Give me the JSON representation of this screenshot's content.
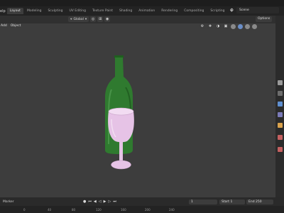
{
  "topbar": {
    "help_label": "elp",
    "tabs": [
      "Layout",
      "Modeling",
      "Sculpting",
      "UV Editing",
      "Texture Paint",
      "Shading",
      "Animation",
      "Rendering",
      "Compositing",
      "Scripting"
    ],
    "active_tab": 0,
    "scene_label": "Scene"
  },
  "header": {
    "orientation": "Global",
    "options_label": "Options"
  },
  "viewport": {
    "menu": [
      "Add",
      "Object"
    ]
  },
  "timeline": {
    "marker_label": "Marker",
    "current_frame": "1",
    "start_label": "Start",
    "start_value": "1",
    "end_label": "End",
    "end_value": "250",
    "ticks": [
      "0",
      "40",
      "80",
      "120",
      "160",
      "200",
      "240"
    ]
  },
  "colors": {
    "bottle": "#2f7a2f",
    "glass": "#e6c3e6",
    "viewport_bg": "#3d3d3d"
  }
}
